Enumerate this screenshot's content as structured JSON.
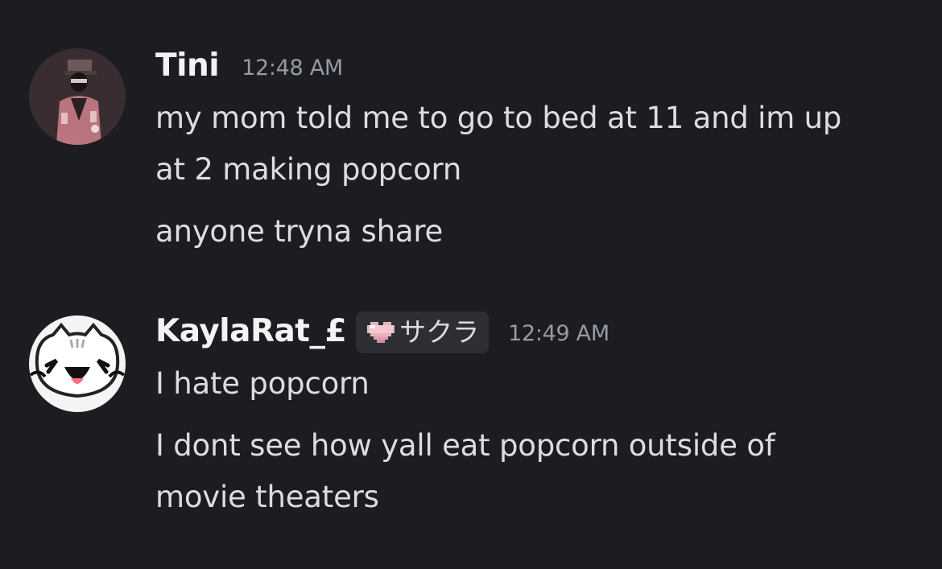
{
  "messages": [
    {
      "author": "Tini",
      "timestamp": "12:48 AM",
      "lines": [
        "my mom told me to go to bed at 11 and im up",
        "at 2 making popcorn"
      ],
      "followup": "anyone tryna share"
    },
    {
      "author": "KaylaRat_£",
      "tag_icon": "pink-heart-icon",
      "tag": "サクラ",
      "timestamp": "12:49 AM",
      "lines": [
        "I hate popcorn"
      ],
      "followup_lines": [
        "I dont see how yall eat popcorn outside of",
        "movie theaters"
      ]
    }
  ],
  "colors": {
    "background": "#1c1c21",
    "username": "#f2f3f5",
    "text": "#dbdee1",
    "timestamp": "#949ba4",
    "tag_bg": "#2e2f35"
  }
}
